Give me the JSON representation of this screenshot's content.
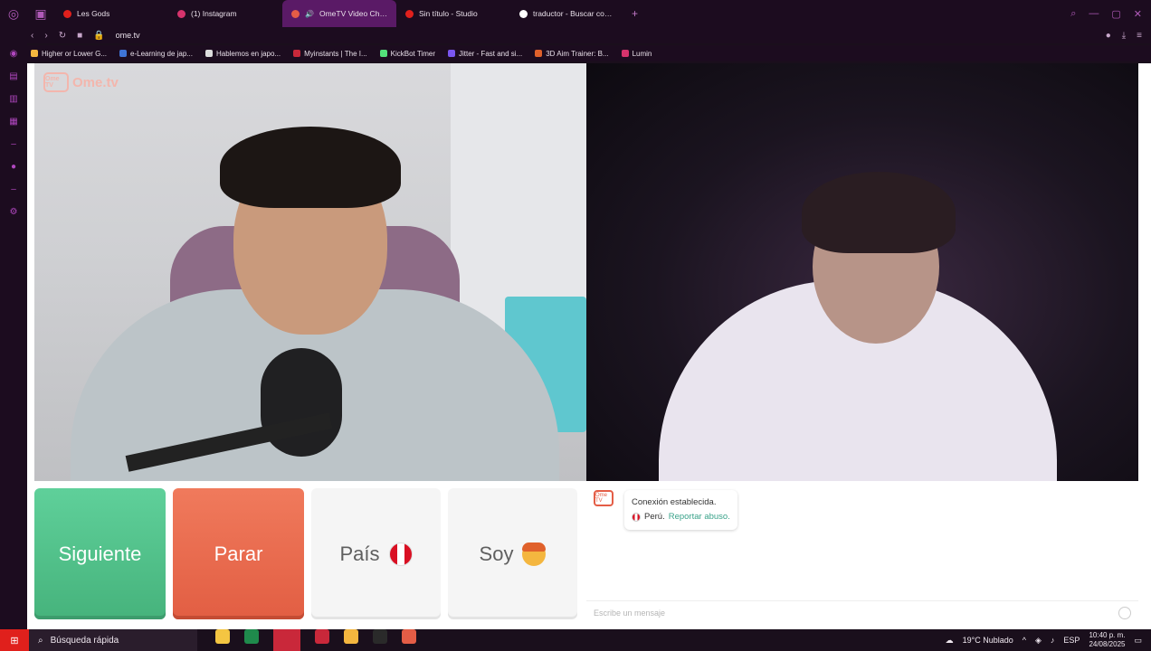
{
  "tabs": [
    {
      "title": "Les Gods",
      "color": "#e0201c"
    },
    {
      "title": "(1) Instagram",
      "color": "#d6336c"
    },
    {
      "title": "OmeTV Video Chat –",
      "color": "#e45d46",
      "active": true
    },
    {
      "title": "Sin título - Studio",
      "color": "#e0201c"
    },
    {
      "title": "traductor - Buscar con G",
      "color": "#ffffff"
    }
  ],
  "address": {
    "url": "ome.tv"
  },
  "bookmarks": [
    {
      "label": "Higher or Lower G...",
      "color": "#f4b63f"
    },
    {
      "label": "e-Learning de jap...",
      "color": "#3f74d6"
    },
    {
      "label": "Hablemos en japo...",
      "color": "#dddddd"
    },
    {
      "label": "Myinstants | The I...",
      "color": "#c9283a"
    },
    {
      "label": "KickBot Timer",
      "color": "#53e07a"
    },
    {
      "label": "Jitter - Fast and si...",
      "color": "#7a56f0"
    },
    {
      "label": "3D Aim Trainer: B...",
      "color": "#e0612b"
    },
    {
      "label": "Lumin",
      "color": "#d6336c"
    }
  ],
  "site": {
    "logo": "Ome.tv",
    "logo_badge": "Ome TV"
  },
  "buttons": {
    "next": "Siguiente",
    "stop": "Parar",
    "country": "País",
    "gender": "Soy"
  },
  "chat": {
    "status": "Conexión establecida.",
    "country": "Perú.",
    "report": "Reportar abuso.",
    "placeholder": "Escribe un mensaje"
  },
  "taskbar": {
    "search": "Búsqueda rápida",
    "weather": "19°C  Nublado",
    "lang": "ESP",
    "time": "10:40 p. m.",
    "date": "24/08/2025"
  }
}
